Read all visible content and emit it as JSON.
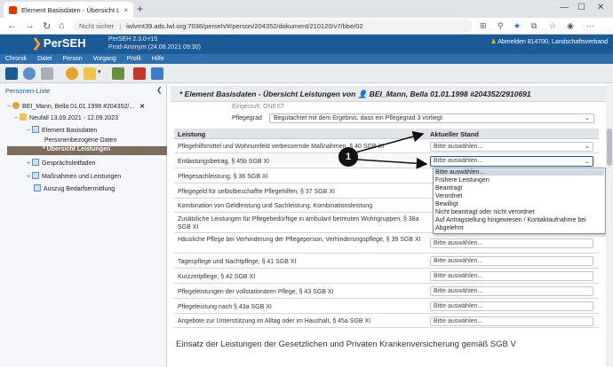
{
  "browser": {
    "tab_title": "Element Basisdaten - Übersicht Lei...",
    "tab_close": "×",
    "new_tab": "+",
    "security": "Nicht sicher",
    "url": "iwlvmt39.ads.lwl.org:7038/perseh/#/person/204352/dokument/210120/v7/bbe/02"
  },
  "app": {
    "logo": "PerSEH",
    "version_line1": "PerSEH 2.3.0-r15",
    "version_line2": "Prod-Anonym (24.08.2021 09:30)",
    "logout": "Abmelden 814700, Landschaftsverband",
    "menu": [
      "Chronik",
      "Datei",
      "Person",
      "Vorgang",
      "Profil",
      "Hilfe"
    ]
  },
  "sidebar": {
    "title": "Personen-Liste",
    "items": [
      {
        "label": "BEI_Mann, Bella 01.01.1998 #204352/..."
      },
      {
        "label": "Neufall 13.09.2021 - 12.09.2023"
      },
      {
        "label": "Element Basisdaten"
      },
      {
        "label": "Personenbezogene Daten"
      },
      {
        "label": "* Übersicht Leistungen"
      },
      {
        "label": "Gesprächsleitfaden"
      },
      {
        "label": "Maßnahmen und Leistungen"
      },
      {
        "label": "Auszug Bedarfsermittlung"
      }
    ]
  },
  "main": {
    "title": "* Element Basisdaten - Übersicht Leistungen von 👤 BEI_Mann, Bella 01.01.1998 #204352/2910691",
    "top_cut": "Eingestuft: ONEST",
    "pflegegrad_label": "Pflegegrad",
    "pflegegrad_value": "Begutachtet mit dem Ergebnis, dass ein Pflegegrad 3 vorliegt",
    "col_leistung": "Leistung",
    "col_stand": "Aktueller Stand",
    "callout": "1",
    "rows": [
      {
        "label": "Pflegehilfsmittel und Wohnumfeld verbessernde Maßnahmen, § 40 SGB XI",
        "value": "Bitte auswählen..."
      },
      {
        "label": "Entlastungsbetrag, § 45b SGB XI",
        "value": "Bitte auswählen..."
      },
      {
        "label": "Pflegesachleistung, § 36 SGB XI",
        "value": ""
      },
      {
        "label": "Pflegegeld für selbstbeschaffte Pflegehilfen, § 37 SGB XI",
        "value": ""
      },
      {
        "label": "Kombination von Geldleistung und Sachleistung, Kombinationsleistung",
        "value": ""
      },
      {
        "label": "Zusätzliche Leistungen für Pflegebedürftige in ambulant betreuten Wohngruppen, § 38a SGB XI",
        "value": ""
      },
      {
        "label": "Häusliche Pflege bei Verhinderung der Pflegeperson, Verhinderungspflege, § 39 SGB XI",
        "value": "Bitte auswählen..."
      },
      {
        "label": "Tagespflege und Nachtpflege, § 41 SGB XI",
        "value": "Bitte auswählen..."
      },
      {
        "label": "Kurzzeitpflege, § 42 SGB XI",
        "value": "Bitte auswählen..."
      },
      {
        "label": "Pflegeleistungen der vollstationären Pflege, § 43 SGB XI",
        "value": "Bitte auswählen..."
      },
      {
        "label": "Pflegeleistung nach § 43a SGB XI",
        "value": "Bitte auswählen..."
      },
      {
        "label": "Angebote zur Unterstützung im Alltag oder im Haushalt, § 45a SGB XI",
        "value": "Bitte auswählen..."
      }
    ],
    "dropdown_options": [
      "Bitte auswählen...",
      "Frühere Leistungen",
      "Beantragt",
      "Verordnet",
      "Bewilligt",
      "Nicht beantragt oder nicht verordnet",
      "Auf Antragstellung hingewiesen / Kontaktaufnahme bei",
      "Abgelehnt"
    ],
    "section2": "Einsatz der Leistungen der Gesetzlichen und Privaten Krankenversicherung gemäß SGB V"
  }
}
